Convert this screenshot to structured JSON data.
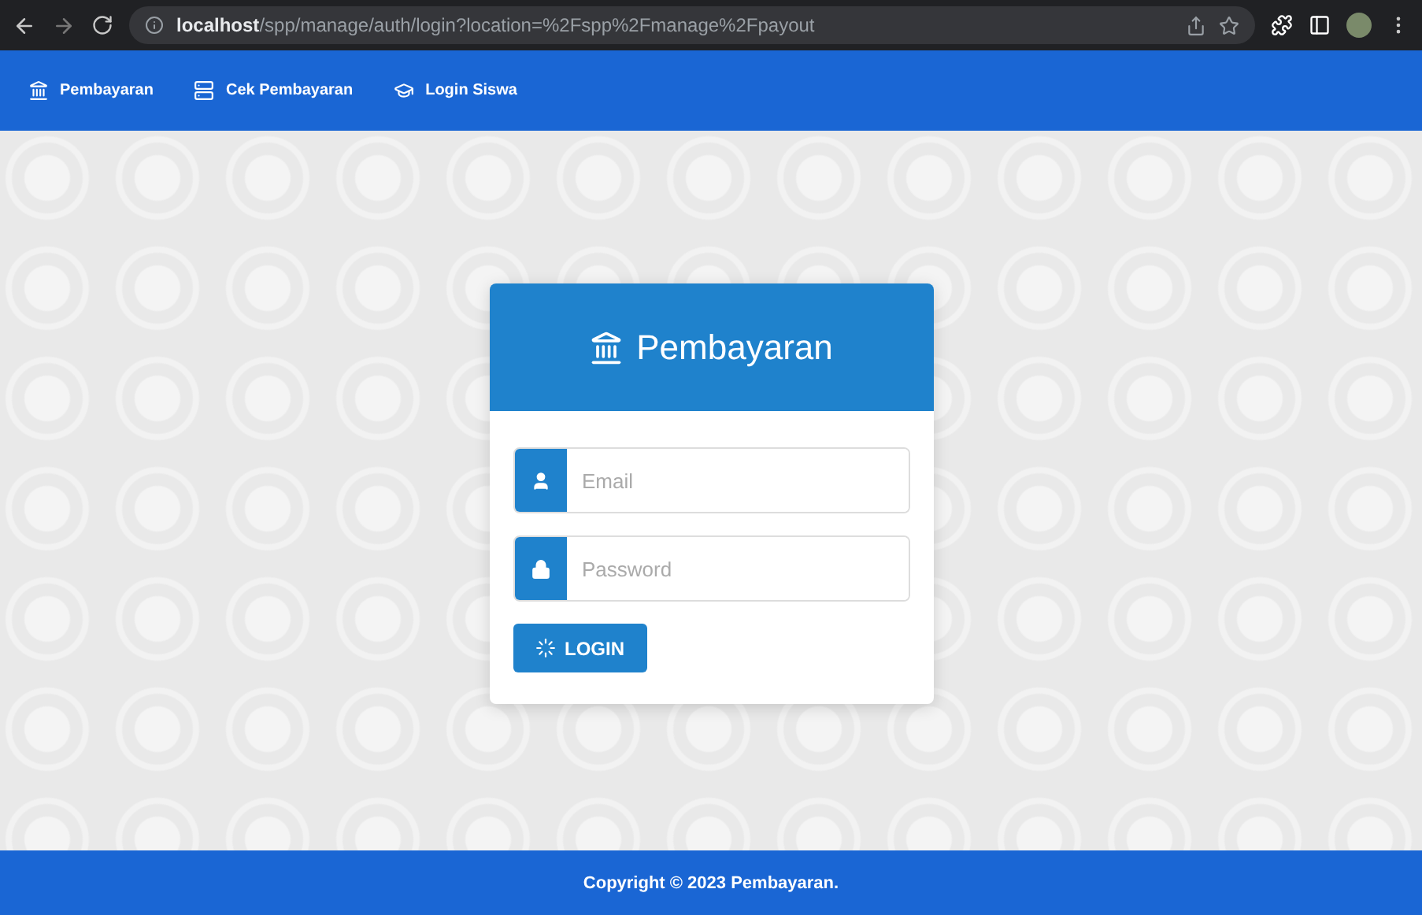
{
  "browser": {
    "url": "**localhost**/spp/manage/auth/login?location=%2Fspp%2Fmanage%2Fpayout"
  },
  "navbar": {
    "items": [
      {
        "label": "Pembayaran"
      },
      {
        "label": "Cek Pembayaran"
      },
      {
        "label": "Login Siswa"
      }
    ]
  },
  "login_card": {
    "title": "Pembayaran",
    "fields": [
      {
        "kind": "email",
        "placeholder": "Email"
      },
      {
        "kind": "password",
        "placeholder": "Password"
      }
    ],
    "button": "LOGIN"
  },
  "footer": {
    "text": "Copyright © 2023 Pembayaran."
  }
}
